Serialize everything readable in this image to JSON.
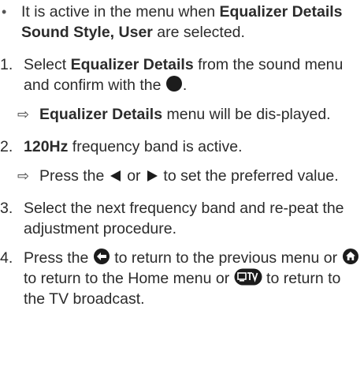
{
  "items": [
    {
      "kind": "bullet",
      "marker": "•",
      "segments": [
        {
          "t": "It is active in the menu when "
        },
        {
          "t": "Equalizer Details Sound Style, User",
          "bold": true
        },
        {
          "t": " are selected."
        }
      ]
    },
    {
      "kind": "step",
      "marker": "1.",
      "segments": [
        {
          "t": "Select "
        },
        {
          "t": "Equalizer Details",
          "bold": true
        },
        {
          "t": " from the sound menu and confirm with the "
        },
        {
          "icon": "ok-button-icon"
        },
        {
          "t": "."
        }
      ]
    },
    {
      "kind": "result",
      "marker": "⇨",
      "segments": [
        {
          "t": "Equalizer Details",
          "bold": true
        },
        {
          "t": " menu will be dis-played."
        }
      ]
    },
    {
      "kind": "step",
      "marker": "2.",
      "segments": [
        {
          "t": "120Hz",
          "bold": true
        },
        {
          "t": " frequency band is active."
        }
      ]
    },
    {
      "kind": "result",
      "marker": "⇨",
      "segments": [
        {
          "t": "Press the "
        },
        {
          "icon": "left-arrow-icon"
        },
        {
          "t": " or "
        },
        {
          "icon": "right-arrow-icon"
        },
        {
          "t": " to set the preferred value."
        }
      ]
    },
    {
      "kind": "step",
      "marker": "3.",
      "segments": [
        {
          "t": "Select the next frequency band and re-peat the adjustment procedure."
        }
      ]
    },
    {
      "kind": "step",
      "marker": "4.",
      "segments": [
        {
          "t": "Press the "
        },
        {
          "icon": "back-button-icon"
        },
        {
          "t": " to return to the previous menu or "
        },
        {
          "icon": "home-button-icon"
        },
        {
          "t": " to return to the Home menu or "
        },
        {
          "icon": "tv-button-icon"
        },
        {
          "t": " to return to the TV broadcast."
        }
      ]
    }
  ],
  "colors": {
    "text": "#2b2b2b",
    "icon_fill": "#1c1c1c"
  }
}
